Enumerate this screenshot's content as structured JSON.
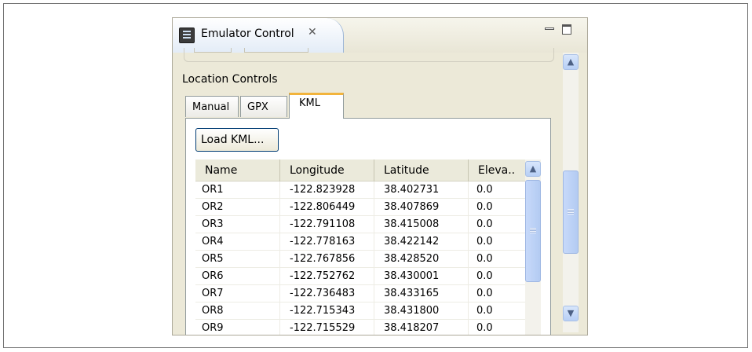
{
  "view": {
    "title": "Emulator Control",
    "close_glyph": "✕",
    "icons": {
      "app": "emulator-control-icon",
      "close": "close-icon",
      "minimize": "minimize-icon",
      "maximize": "maximize-icon"
    }
  },
  "location_controls": {
    "label": "Location Controls",
    "tabs": [
      {
        "label": "Manual",
        "selected": false
      },
      {
        "label": "GPX",
        "selected": false
      },
      {
        "label": "KML",
        "selected": true
      }
    ],
    "load_button": "Load KML...",
    "table": {
      "columns": [
        "Name",
        "Longitude",
        "Latitude",
        "Eleva.."
      ],
      "rows": [
        [
          "OR1",
          "-122.823928",
          "38.402731",
          "0.0"
        ],
        [
          "OR2",
          "-122.806449",
          "38.407869",
          "0.0"
        ],
        [
          "OR3",
          "-122.791108",
          "38.415008",
          "0.0"
        ],
        [
          "OR4",
          "-122.778163",
          "38.422142",
          "0.0"
        ],
        [
          "OR5",
          "-122.767856",
          "38.428520",
          "0.0"
        ],
        [
          "OR6",
          "-122.752762",
          "38.430001",
          "0.0"
        ],
        [
          "OR7",
          "-122.736483",
          "38.433165",
          "0.0"
        ],
        [
          "OR8",
          "-122.715343",
          "38.431800",
          "0.0"
        ],
        [
          "OR9",
          "-122.715529",
          "38.418207",
          "0.0"
        ]
      ]
    }
  },
  "scroll_glyphs": {
    "up": "▲",
    "down": "▼"
  },
  "colors": {
    "selected_tab_accent": "#f2b43c",
    "scroll_button": "#c9dbf8"
  }
}
